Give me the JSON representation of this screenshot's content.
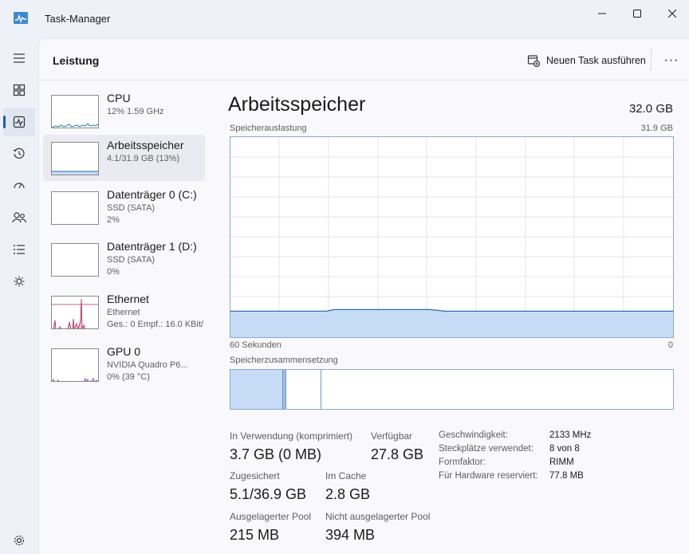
{
  "window": {
    "title": "Task-Manager"
  },
  "header": {
    "title": "Leistung",
    "run_task_label": "Neuen Task ausführen",
    "more_label": "···"
  },
  "rail": {
    "items": [
      {
        "icon": "hamburger-menu-icon"
      },
      {
        "icon": "processes-icon"
      },
      {
        "icon": "performance-icon",
        "active": true
      },
      {
        "icon": "app-history-icon"
      },
      {
        "icon": "startup-apps-icon"
      },
      {
        "icon": "users-icon"
      },
      {
        "icon": "details-icon"
      },
      {
        "icon": "services-icon"
      },
      {
        "icon": "settings-icon"
      }
    ]
  },
  "devices": [
    {
      "name": "CPU",
      "line1": "12%  1.59 GHz",
      "line2": ""
    },
    {
      "name": "Arbeitsspeicher",
      "line1": "4.1/31.9 GB (13%)",
      "line2": ""
    },
    {
      "name": "Datenträger 0 (C:)",
      "line1": "SSD (SATA)",
      "line2": "2%"
    },
    {
      "name": "Datenträger 1 (D:)",
      "line1": "SSD (SATA)",
      "line2": "0%"
    },
    {
      "name": "Ethernet",
      "line1": "Ethernet",
      "line2": "Ges.: 0 Empf.: 16.0 KBit/"
    },
    {
      "name": "GPU 0",
      "line1": "NVIDIA Quadro P6...",
      "line2": "0%  (39 °C)"
    }
  ],
  "main": {
    "title": "Arbeitsspeicher",
    "total": "32.0 GB",
    "usage_label": "Speicherauslastung",
    "usage_max": "31.9 GB",
    "time_label": "60 Sekunden",
    "time_end": "0",
    "composition_label": "Speicherzusammensetzung",
    "usage_fraction": 0.13
  },
  "stats": {
    "in_use_label": "In Verwendung (komprimiert)",
    "in_use_value": "3.7 GB (0 MB)",
    "available_label": "Verfügbar",
    "available_value": "27.8 GB",
    "committed_label": "Zugesichert",
    "committed_value": "5.1/36.9 GB",
    "cached_label": "Im Cache",
    "cached_value": "2.8 GB",
    "paged_pool_label": "Ausgelagerter Pool",
    "paged_pool_value": "215 MB",
    "nonpaged_pool_label": "Nicht ausgelagerter Pool",
    "nonpaged_pool_value": "394 MB"
  },
  "specs": [
    {
      "label": "Geschwindigkeit:",
      "value": "2133 MHz"
    },
    {
      "label": "Steckplätze verwendet:",
      "value": "8 von 8"
    },
    {
      "label": "Formfaktor:",
      "value": "RIMM"
    },
    {
      "label": "Für Hardware reserviert:",
      "value": "77.8 MB"
    }
  ],
  "colors": {
    "memory_line": "#2a6fb0",
    "memory_fill": "#c6dcf6",
    "ethernet": "#b3325d",
    "gpu": "#8a4fc9",
    "cpu": "#1f7fa8",
    "accent": "#1a5fb4"
  }
}
